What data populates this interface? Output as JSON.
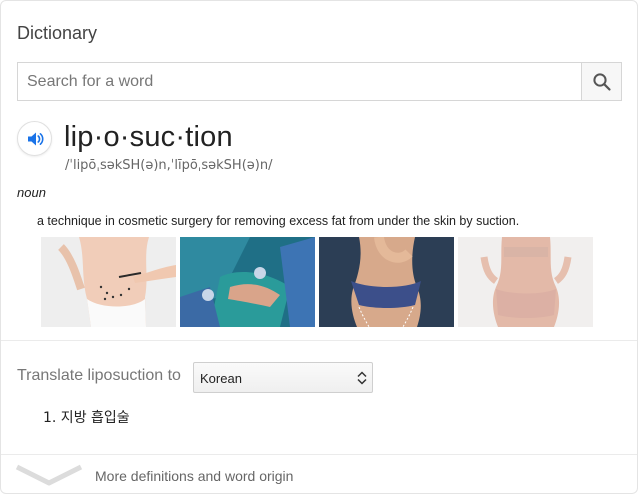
{
  "title": "Dictionary",
  "search": {
    "placeholder": "Search for a word",
    "value": ""
  },
  "entry": {
    "word": "lip·o·suc·tion",
    "phonetic": "/ˈlipōˌsəkSH(ə)n,ˈlīpōˌsəkSH(ə)n/",
    "part_of_speech": "noun",
    "definition": "a technique in cosmetic surgery for removing excess fat from under the skin by suction."
  },
  "images": [
    {
      "icon": "image-abdomen-markings"
    },
    {
      "icon": "image-surgery-scene"
    },
    {
      "icon": "image-body-outline"
    },
    {
      "icon": "image-back-view"
    }
  ],
  "translate": {
    "label": "Translate liposuction to",
    "language": "Korean",
    "results": [
      "1. 지방 흡입술"
    ]
  },
  "more": {
    "label": "More definitions and word origin"
  },
  "colors": {
    "accent": "#1a73e8",
    "divider": "#ebebeb"
  }
}
